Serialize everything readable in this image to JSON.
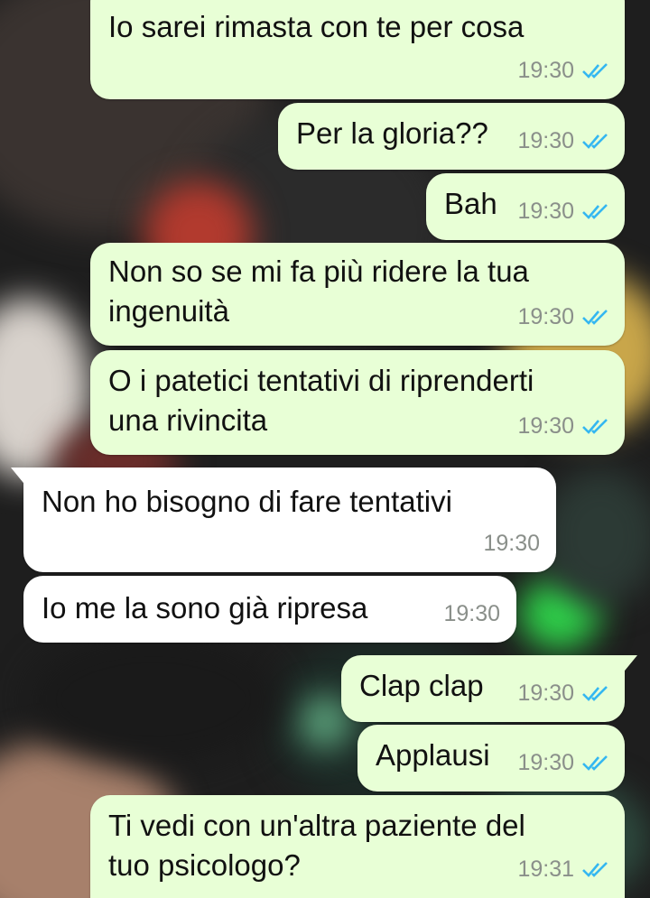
{
  "colors": {
    "outgoing_bubble": "#e8ffd6",
    "incoming_bubble": "#ffffff",
    "read_ticks": "#34b7f1",
    "timestamp": "#8a8f8a"
  },
  "messages": [
    {
      "direction": "outgoing",
      "text": "Io sarei rimasta con te per cosa",
      "time": "19:30",
      "status_icon": "double-check-read-icon"
    },
    {
      "direction": "outgoing",
      "text": "Per la gloria??",
      "time": "19:30",
      "status_icon": "double-check-read-icon"
    },
    {
      "direction": "outgoing",
      "text": "Bah",
      "time": "19:30",
      "status_icon": "double-check-read-icon"
    },
    {
      "direction": "outgoing",
      "line1": "Non so se mi fa più ridere la tua",
      "line2": "ingenuità",
      "time": "19:30",
      "status_icon": "double-check-read-icon"
    },
    {
      "direction": "outgoing",
      "line1": "O i patetici tentativi di riprenderti",
      "line2": "una rivincita",
      "time": "19:30",
      "status_icon": "double-check-read-icon"
    },
    {
      "direction": "incoming",
      "text": "Non ho bisogno di fare tentativi",
      "time": "19:30"
    },
    {
      "direction": "incoming",
      "text": "Io me la sono già ripresa",
      "time": "19:30"
    },
    {
      "direction": "outgoing",
      "text": "Clap clap",
      "time": "19:30",
      "status_icon": "double-check-read-icon"
    },
    {
      "direction": "outgoing",
      "text": "Applausi",
      "time": "19:30",
      "status_icon": "double-check-read-icon"
    },
    {
      "direction": "outgoing",
      "line1": "Ti vedi con un'altra paziente del",
      "line2": "tuo psicologo?",
      "time": "19:31",
      "status_icon": "double-check-read-icon"
    }
  ]
}
